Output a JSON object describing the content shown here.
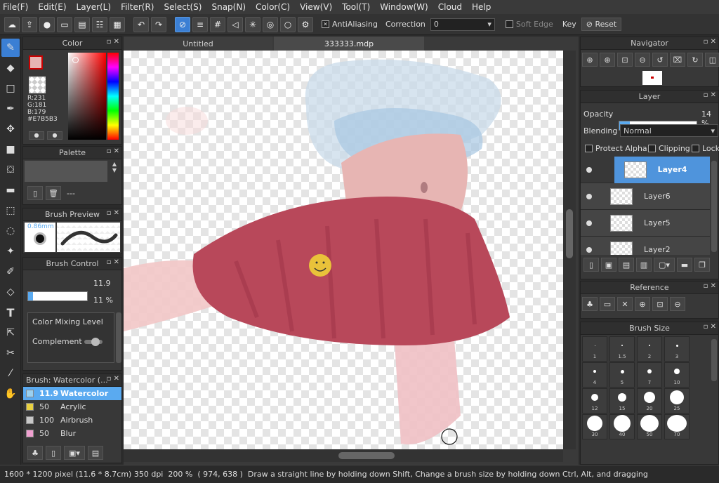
{
  "menu": [
    "File(F)",
    "Edit(E)",
    "Layer(L)",
    "Filter(R)",
    "Select(S)",
    "Snap(N)",
    "Color(C)",
    "View(V)",
    "Tool(T)",
    "Window(W)",
    "Cloud",
    "Help"
  ],
  "toolbar": {
    "antialiasing_label": "AntiAliasing",
    "correction_label": "Correction",
    "correction_value": "0",
    "soft_edge_label": "Soft Edge",
    "key_label": "Key",
    "reset_label": "Reset"
  },
  "color_panel": {
    "title": "Color",
    "r": "R:231",
    "g": "G:181",
    "b": "B:179",
    "hex": "#E7B5B3",
    "foreground": "#E7B5B3"
  },
  "palette_panel": {
    "title": "Palette",
    "value": "---"
  },
  "brush_preview": {
    "title": "Brush Preview",
    "size": "0.86mm"
  },
  "brush_control": {
    "title": "Brush Control",
    "size_value": "11.9",
    "size_fraction": 0.08,
    "opacity_value": "11 %",
    "opacity_fraction": 0.11,
    "color_mixing_label": "Color Mixing Level",
    "complement_label": "Complement"
  },
  "brush_list": {
    "title": "Brush: Watercolor (...",
    "items": [
      {
        "size": "11.9",
        "name": "Watercolor",
        "color": "#9ad0f0",
        "selected": true
      },
      {
        "size": "50",
        "name": "Acrylic",
        "color": "#e8d040",
        "selected": false
      },
      {
        "size": "100",
        "name": "Airbrush",
        "color": "#c8c8c8",
        "selected": false
      },
      {
        "size": "50",
        "name": "Blur",
        "color": "#f0a0d0",
        "selected": false
      }
    ]
  },
  "tabs": {
    "untitled": "Untitled",
    "active": "333333.mdp"
  },
  "navigator": {
    "title": "Navigator"
  },
  "layer_panel": {
    "title": "Layer",
    "opacity_label": "Opacity",
    "opacity_value": "14 %",
    "opacity_fraction": 0.14,
    "blending_label": "Blending",
    "blending_value": "Normal",
    "protect_alpha": "Protect Alpha",
    "clipping": "Clipping",
    "lock": "Lock",
    "layers": [
      {
        "name": "Layer4",
        "selected": true
      },
      {
        "name": "Layer6",
        "selected": false
      },
      {
        "name": "Layer5",
        "selected": false
      },
      {
        "name": "Layer2",
        "selected": false
      }
    ]
  },
  "reference_panel": {
    "title": "Reference"
  },
  "brush_size_panel": {
    "title": "Brush Size",
    "sizes": [
      "1",
      "1.5",
      "2",
      "3",
      "4",
      "5",
      "7",
      "10",
      "12",
      "15",
      "20",
      "25",
      "30",
      "40",
      "50",
      "70"
    ]
  },
  "status": {
    "pixels": "1600 * 1200 pixel",
    "cm": "(11.6 * 8.7cm)",
    "dpi": "350 dpi",
    "zoom": "200 %",
    "coords": "( 974, 638 )",
    "hint": "Draw a straight line by holding down Shift, Change a brush size by holding down Ctrl, Alt, and dragging"
  }
}
